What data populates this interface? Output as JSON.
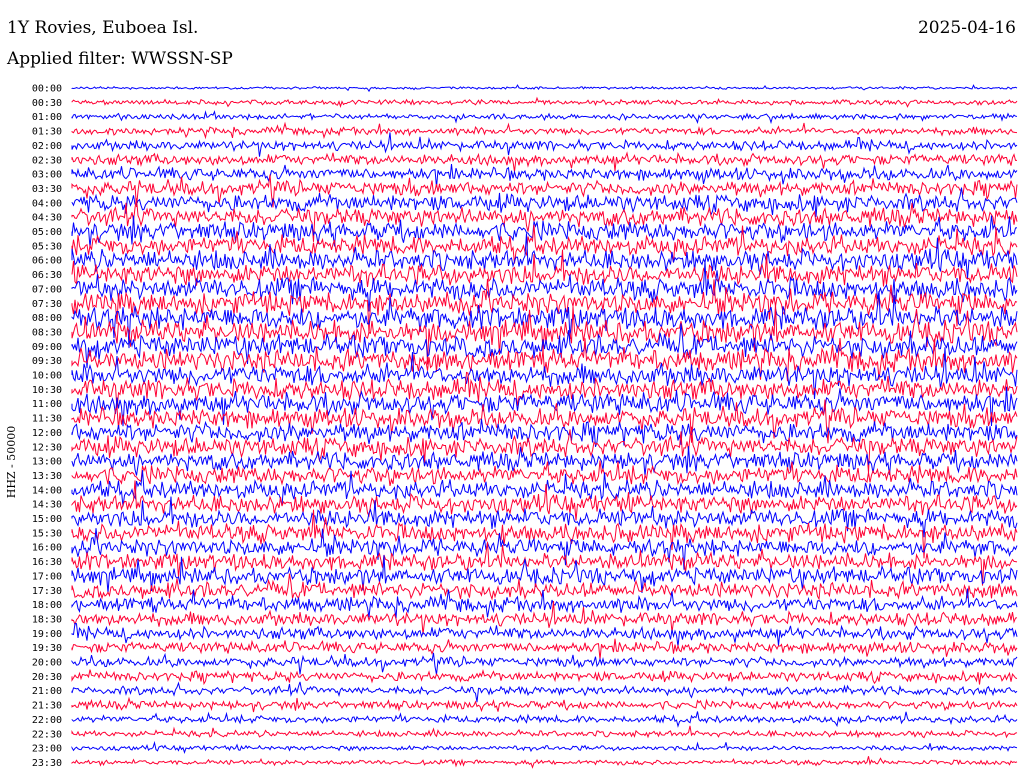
{
  "header": {
    "station": "1Y Rovies, Euboea Isl.",
    "date": "2025-04-16",
    "filter": "Applied filter: WWSSN-SP"
  },
  "chart_data": {
    "type": "line",
    "ylabel": "HHZ - 50000",
    "row_labels": [
      "00:00",
      "00:30",
      "01:00",
      "01:30",
      "02:00",
      "02:30",
      "03:00",
      "03:30",
      "04:00",
      "04:30",
      "05:00",
      "05:30",
      "06:00",
      "06:30",
      "07:00",
      "07:30",
      "08:00",
      "08:30",
      "09:00",
      "09:30",
      "10:00",
      "10:30",
      "11:00",
      "11:30",
      "12:00",
      "12:30",
      "13:00",
      "13:30",
      "14:00",
      "14:30",
      "15:00",
      "15:30",
      "16:00",
      "16:30",
      "17:00",
      "17:30",
      "18:00",
      "18:30",
      "19:00",
      "19:30",
      "20:00",
      "20:30",
      "21:00",
      "21:30",
      "22:00",
      "22:30",
      "23:00",
      "23:30"
    ],
    "colors": {
      "even_rows": "#0000ff",
      "odd_rows": "#ff0033"
    },
    "relative_amplitude": [
      0.2,
      0.4,
      0.45,
      0.6,
      0.8,
      0.9,
      1.0,
      1.2,
      1.4,
      1.5,
      1.6,
      1.6,
      1.7,
      1.7,
      1.8,
      1.8,
      1.9,
      1.9,
      1.8,
      1.8,
      1.7,
      1.7,
      1.7,
      1.6,
      1.6,
      1.6,
      1.5,
      1.5,
      1.5,
      1.5,
      1.5,
      1.5,
      1.4,
      1.4,
      1.4,
      1.3,
      1.2,
      1.1,
      1.0,
      0.9,
      0.8,
      0.8,
      0.7,
      0.7,
      0.6,
      0.5,
      0.4,
      0.4
    ]
  }
}
